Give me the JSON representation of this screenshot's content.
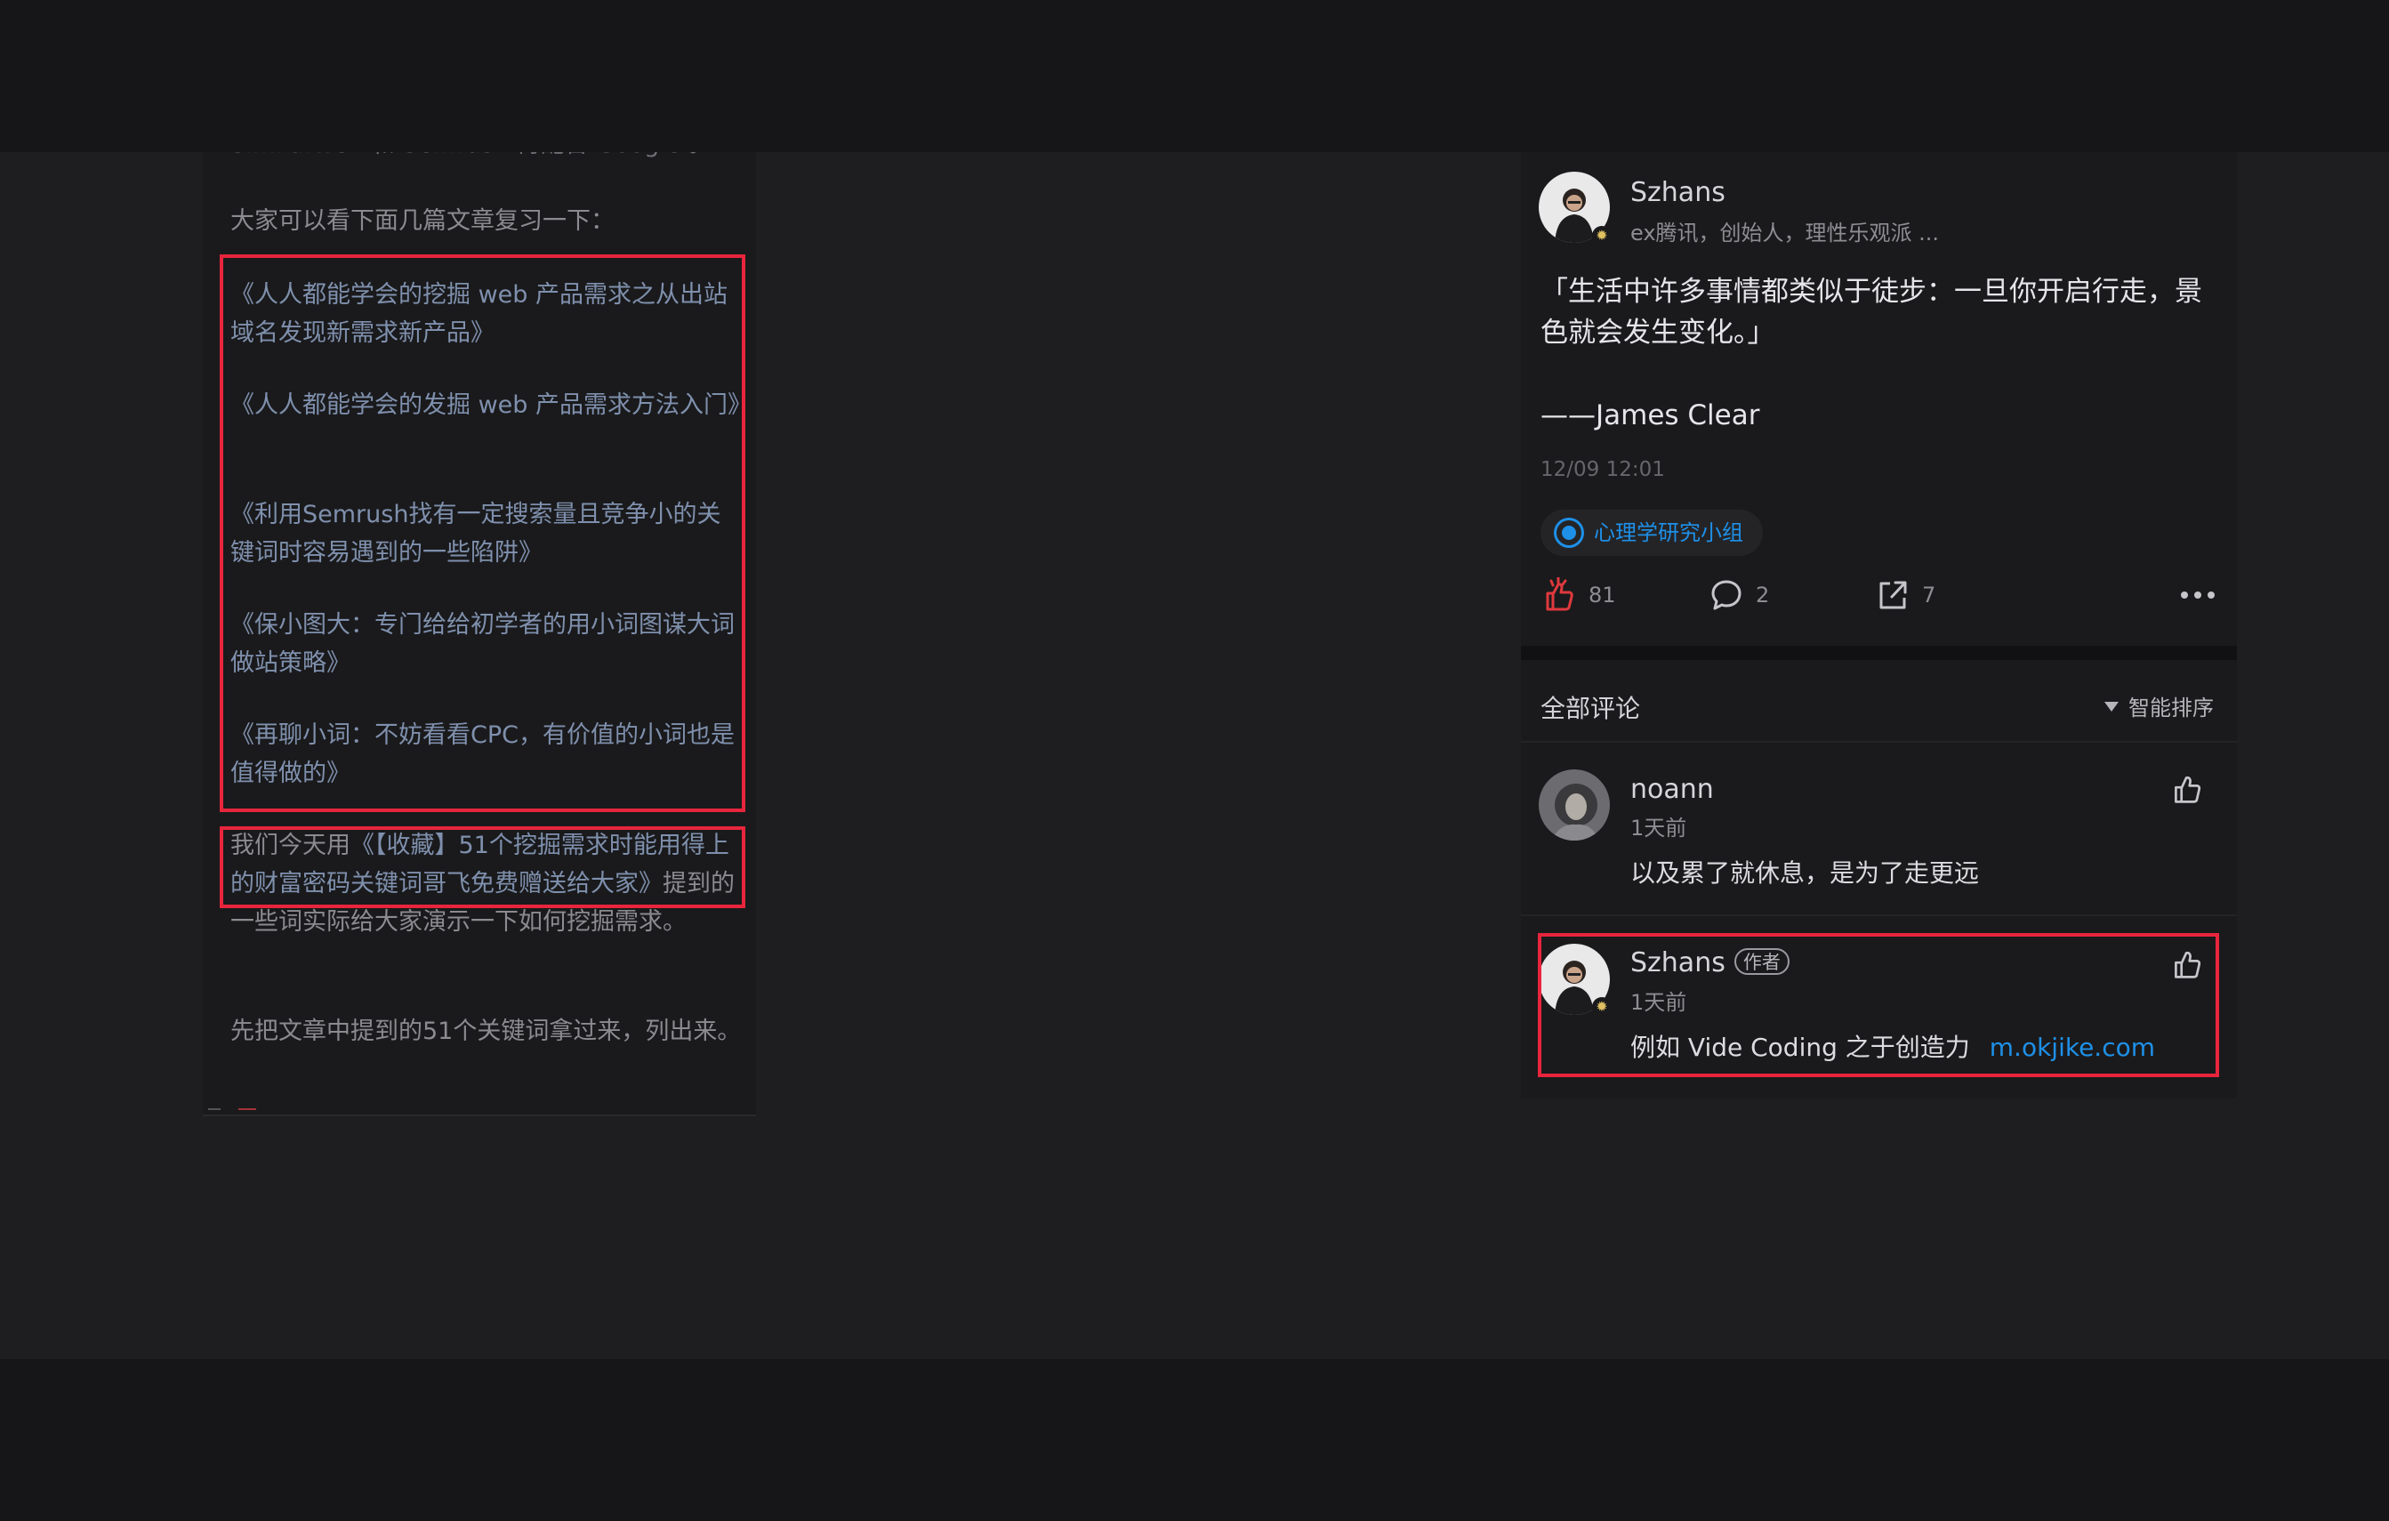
{
  "article": {
    "cut_line": "Similarweb 和 Semrush 再配合 Google 。",
    "intro": "大家可以看下面几篇文章复习一下：",
    "links": [
      "《人人都能学会的挖掘 web 产品需求之从出站域名发现新需求新产品》",
      "《人人都能学会的发掘 web 产品需求方法入门》",
      "《利用Semrush找有一定搜索量且竞争小的关键词时容易遇到的一些陷阱》",
      "《保小图大：专门给给初学者的用小词图谋大词做站策略》",
      "《再聊小词：不妨看看CPC，有价值的小词也是值得做的》"
    ],
    "p_today_prefix": "我们今天用",
    "p_today_link": "《【收藏】51个挖掘需求时能用得上的财富密码关键词哥飞免费赠送给大家》",
    "p_today_suffix": "提到的一些词实际给大家演示一下如何挖掘需求。",
    "p_last": "先把文章中提到的51个关键词拿过来，列出来。"
  },
  "post": {
    "author_name": "Szhans",
    "author_bio": "ex腾讯，创始人，理性乐观派 ...",
    "quote_line1": "「生活中许多事情都类似于徒步：一旦你开启行走，景色就会发生变化。」",
    "quote_line2": "——James  Clear",
    "timestamp": "12/09 12:01",
    "topic": "心理学研究小组",
    "likes": "81",
    "comments": "2",
    "shares": "7"
  },
  "comments_header": {
    "title": "全部评论",
    "sort_label": "智能排序"
  },
  "comments": [
    {
      "name": "noann",
      "time": "1天前",
      "text": "以及累了就休息，是为了走更远"
    },
    {
      "name": "Szhans",
      "badge": "作者",
      "time": "1天前",
      "text": "例如 Vide Coding 之于创造力",
      "link": "m.okjike.com"
    }
  ],
  "colors": {
    "highlight_box": "#e8253d",
    "link_blue": "#1e90e8",
    "like_red": "#e0393e"
  }
}
